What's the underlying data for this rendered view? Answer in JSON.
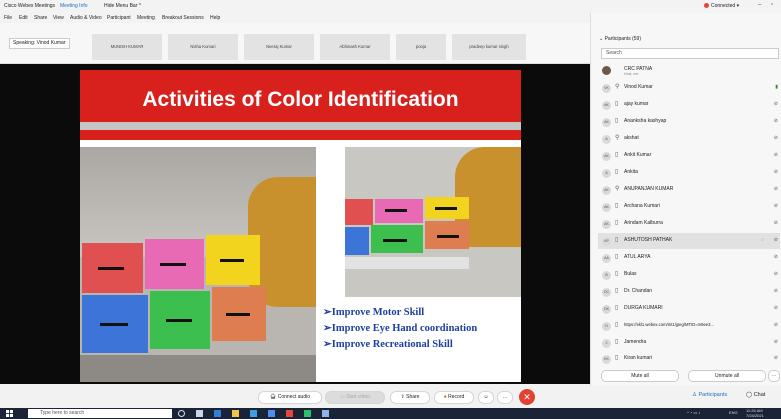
{
  "window": {
    "tabs": [
      "Cisco Webex Meetings",
      "Meeting Info",
      "Hide Menu Bar ^"
    ],
    "connection": "Connected"
  },
  "menu": [
    "File",
    "Edit",
    "Share",
    "View",
    "Audio & Video",
    "Participant",
    "Meeting",
    "Breakout Sessions",
    "Help"
  ],
  "strip": {
    "speaking": "Speaking: Vinod Kumar",
    "thumbnails": [
      "MUNISH KUMAR",
      "Nisha Kumari",
      "Neeraj Kumar",
      "Abhinash Kumar",
      "pooja",
      "pradeep kumar singh"
    ]
  },
  "slide": {
    "title": "Activities of Color Identification",
    "bullets": [
      "➢Improve Motor Skill",
      "➢Improve Eye Hand coordination",
      "➢Improve Recreational Skill"
    ],
    "colors": {
      "banner": "#d8201d",
      "bullet": "#1f3fa0"
    }
  },
  "controls": {
    "audio": "Connect audio",
    "video": "Start video",
    "share": "Share",
    "record": "Record",
    "more": "…",
    "leave": "✕"
  },
  "panel": {
    "header": "Participants (59)",
    "search_placeholder": "Search",
    "participants": [
      {
        "initials": "",
        "name": "CRC PATNA",
        "sub": "Host, me",
        "icon": ""
      },
      {
        "initials": "VK",
        "name": "Vinod Kumar",
        "sub": "",
        "icon": "⚲"
      },
      {
        "initials": "AK",
        "name": "ajay kumar",
        "sub": "",
        "icon": "▯"
      },
      {
        "initials": "AK",
        "name": "Ananksha kashyap",
        "sub": "",
        "icon": "▯"
      },
      {
        "initials": "A",
        "name": "akshat",
        "sub": "",
        "icon": "⚲"
      },
      {
        "initials": "AK",
        "name": "Ankit Kumar",
        "sub": "",
        "icon": "▯"
      },
      {
        "initials": "A",
        "name": "Ankita",
        "sub": "",
        "icon": "▯"
      },
      {
        "initials": "AK",
        "name": "ANUPANJAN KUMAR",
        "sub": "",
        "icon": "⚲"
      },
      {
        "initials": "AK",
        "name": "Archana Kumari",
        "sub": "",
        "icon": "▯"
      },
      {
        "initials": "AK",
        "name": "Arindam Kalburra",
        "sub": "",
        "icon": "▯"
      },
      {
        "initials": "AP",
        "name": "ASHUTOSH PATHAK",
        "sub": "",
        "icon": "▯"
      },
      {
        "initials": "AA",
        "name": "ATUL ARYA",
        "sub": "",
        "icon": "▯"
      },
      {
        "initials": "B",
        "name": "Bulas",
        "sub": "",
        "icon": "▯"
      },
      {
        "initials": "DC",
        "name": "Dr. Chandan",
        "sub": "",
        "icon": "▯"
      },
      {
        "initials": "DK",
        "name": "DURGA KUMARI",
        "sub": "",
        "icon": "▯"
      },
      {
        "initials": "H",
        "name": "https://ekl1.webex.com/mt1/jpeg/MTID=m9ee3...",
        "sub": "",
        "icon": "▯"
      },
      {
        "initials": "J",
        "name": "Jamendra",
        "sub": "",
        "icon": "▯"
      },
      {
        "initials": "KK",
        "name": "Kiran kumari",
        "sub": "",
        "icon": "▯"
      }
    ],
    "mute_all": "Mute all",
    "unmute_all": "Unmute all",
    "tab_participants": "Participants",
    "tab_chat": "Chat"
  },
  "taskbar": {
    "search_placeholder": "Type here to search",
    "lang": "ENG",
    "time": "11:26 AM",
    "date": "7/24/2021"
  }
}
